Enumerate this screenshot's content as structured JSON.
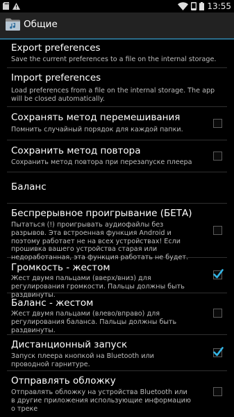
{
  "status_bar": {
    "time": "13:55",
    "icons": [
      "sd-card-icon",
      "warning-icon",
      "wifi-icon",
      "phone-icon",
      "battery-icon"
    ]
  },
  "action_bar": {
    "title": "Общие",
    "icon": "music-folder-icon"
  },
  "preferences": [
    {
      "title": "Export preferences",
      "summary": "Save the current preferences to a file on the internal storage."
    },
    {
      "title": "Import preferences",
      "summary": "Load preferences from a file on the internal storage. The app will be closed automatically."
    },
    {
      "title": "Сохранять метод перемешивания",
      "summary": "Помнить случайный порядок для каждой папки.",
      "checked": false
    },
    {
      "title": "Сохранить метод повтора",
      "summary": "Сохранить метод повтора при перезапуске плеера",
      "checked": false
    },
    {
      "title": "Баланс"
    },
    {
      "title": "Беспрерывное проигрывание (БЕТА)",
      "summary": "Пытаться (!) проигрывать аудиофайлы без разрывов. Эта встроенная функция Android и поэтому работает не на всех устройствах! Если прошивка вашего устройства старая или недоработанная, эта функция работать не будет.",
      "checked": false
    },
    {
      "title": "Громкость - жестом",
      "summary": "Жест двумя пальцами (вверх/вниз) для регулирования громкости. Пальцы должны быть раздвинуты.",
      "checked": true
    },
    {
      "title": "Баланс - жестом",
      "summary": "Жест двумя пальцами (влево/вправо) для регулирования баланса. Пальцы должны быть раздвинуты.",
      "checked": false
    },
    {
      "title": "Дистанционный запуск",
      "summary": "Запуск плеера кнопкой на Bluetooth или проводной гарнитуре.",
      "checked": true
    },
    {
      "title": "Отправлять обложку",
      "summary": "Отправлять обложку на устройства Bluetooth или в другие приложения использующие информацию о треке",
      "checked": false
    }
  ],
  "colors": {
    "background": "#000000",
    "action_bar": "#222222",
    "accent": "#33b5e5",
    "divider": "#303030"
  }
}
